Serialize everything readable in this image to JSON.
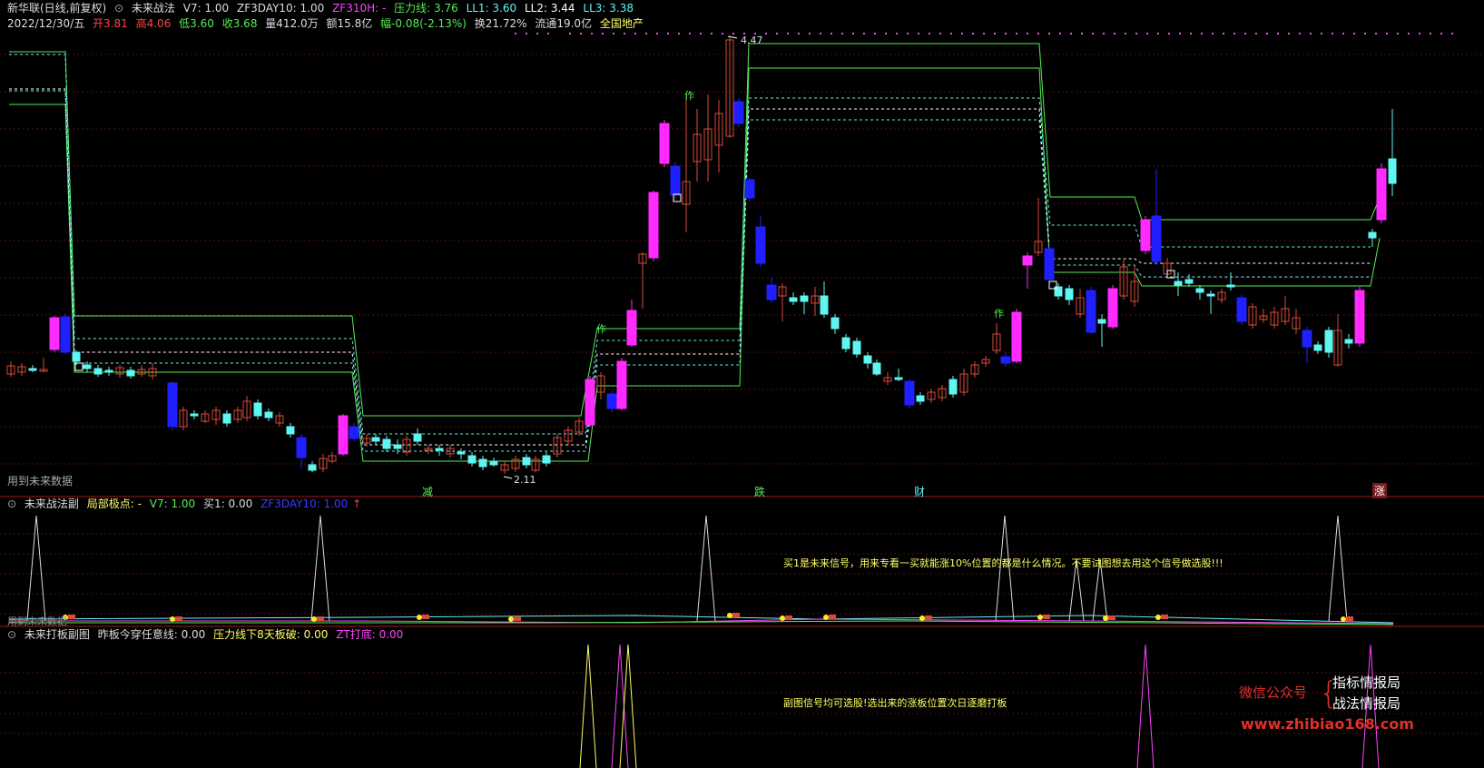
{
  "header": {
    "row1": [
      {
        "text": "新华联(日线,前复权)",
        "color": "#dddddd"
      },
      {
        "text": "未来战法",
        "color": "#dddddd"
      },
      {
        "text": "V7: 1.00",
        "color": "#dddddd"
      },
      {
        "text": "ZF3DAY10: 1.00",
        "color": "#dddddd"
      },
      {
        "text": "ZF310H: -",
        "color": "#ff44ff"
      },
      {
        "text": "压力线: 3.76",
        "color": "#55ee55"
      },
      {
        "text": "LL1: 3.60",
        "color": "#5ff5f0"
      },
      {
        "text": "LL2: 3.44",
        "color": "#ffffff"
      },
      {
        "text": "LL3: 3.38",
        "color": "#5ff5f0"
      }
    ],
    "row2": [
      {
        "text": "2022/12/30/五",
        "color": "#dddddd"
      },
      {
        "text": "开3.81",
        "color": "#ff4444"
      },
      {
        "text": "高4.06",
        "color": "#ff4444"
      },
      {
        "text": "低3.60",
        "color": "#55ee55"
      },
      {
        "text": "收3.68",
        "color": "#55ee55"
      },
      {
        "text": "量412.0万",
        "color": "#dddddd"
      },
      {
        "text": "额15.8亿",
        "color": "#dddddd"
      },
      {
        "text": "幅-0.08(-2.13%)",
        "color": "#55ee55"
      },
      {
        "text": "换21.72%",
        "color": "#dddddd"
      },
      {
        "text": "流通19.0亿",
        "color": "#dddddd"
      },
      {
        "text": "全国地产",
        "color": "#ffff66"
      }
    ]
  },
  "main_chart": {
    "future_data_label": "用到未来数据",
    "high_label": "4.47",
    "low_label": "2.11",
    "zuo_label": "作",
    "markers": [
      {
        "text": "减",
        "color": "#55ee55"
      },
      {
        "text": "跌",
        "color": "#55ee55"
      },
      {
        "text": "财",
        "color": "#5ff5f0"
      },
      {
        "text": "涨",
        "color": "#ff4444"
      }
    ],
    "colors": {
      "up_outline": "#d84a3a",
      "up_fill": "#ff2aff",
      "down_fill": "#2020ff",
      "down_small": "#5ff5f0",
      "pressure_line": "#55ee55"
    }
  },
  "panel2": {
    "title": "未来战法副",
    "items": [
      {
        "text": "局部极点: -",
        "color": "#ffff66"
      },
      {
        "text": "V7: 1.00",
        "color": "#55ee55"
      },
      {
        "text": "买1: 0.00",
        "color": "#dddddd"
      },
      {
        "text": "ZF3DAY10: 1.00",
        "color": "#3a3aff"
      }
    ],
    "note": "买1是未来信号，用来专看一买就能涨10%位置的都是什么情况。不要试图想去用这个信号做选股!!!",
    "future_label": "用到未来数据"
  },
  "panel3": {
    "title": "未来打板副图",
    "items": [
      {
        "text": "昨板今穿任意线: 0.00",
        "color": "#dddddd"
      },
      {
        "text": "压力线下8天板破: 0.00",
        "color": "#ffff66"
      },
      {
        "text": "ZT打底: 0.00",
        "color": "#ff44ff"
      }
    ],
    "note": "副图信号均可选股!选出来的涨板位置次日逐磨打板"
  },
  "watermark": {
    "wechat": "微信公众号",
    "name1": "指标情报局",
    "name2": "战法情报局",
    "url": "www.zhibiao168.com"
  }
}
